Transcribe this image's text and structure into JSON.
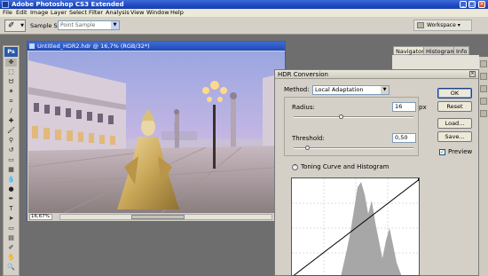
{
  "app": {
    "title": "Adobe Photoshop CS3 Extended",
    "window_buttons": [
      "_",
      "□",
      "×"
    ]
  },
  "menu": [
    "File",
    "Edit",
    "Image",
    "Layer",
    "Select",
    "Filter",
    "Analysis",
    "View",
    "Window",
    "Help"
  ],
  "options_bar": {
    "sample_size_label": "Sample Size:",
    "sample_size_value": "Point Sample",
    "workspace_label": "Workspace ▾"
  },
  "toolbox": {
    "logo": "Ps",
    "tools": [
      {
        "name": "move-tool-icon",
        "glyph": "✥"
      },
      {
        "name": "marquee-tool-icon",
        "glyph": "⬚"
      },
      {
        "name": "lasso-tool-icon",
        "glyph": "ᗢ"
      },
      {
        "name": "magic-wand-tool-icon",
        "glyph": "✶"
      },
      {
        "name": "crop-tool-icon",
        "glyph": "⌗"
      },
      {
        "name": "slice-tool-icon",
        "glyph": "∕"
      },
      {
        "name": "healing-brush-icon",
        "glyph": "✚"
      },
      {
        "name": "brush-tool-icon",
        "glyph": "🖌"
      },
      {
        "name": "clone-stamp-icon",
        "glyph": "⚲"
      },
      {
        "name": "history-brush-icon",
        "glyph": "↺"
      },
      {
        "name": "eraser-tool-icon",
        "glyph": "▭"
      },
      {
        "name": "gradient-tool-icon",
        "glyph": "▦"
      },
      {
        "name": "blur-tool-icon",
        "glyph": "💧"
      },
      {
        "name": "dodge-tool-icon",
        "glyph": "●"
      },
      {
        "name": "pen-tool-icon",
        "glyph": "✒"
      },
      {
        "name": "type-tool-icon",
        "glyph": "T"
      },
      {
        "name": "path-selection-icon",
        "glyph": "➤"
      },
      {
        "name": "shape-tool-icon",
        "glyph": "▭"
      },
      {
        "name": "notes-tool-icon",
        "glyph": "▤"
      },
      {
        "name": "eyedropper-tool-icon",
        "glyph": "✐"
      },
      {
        "name": "hand-tool-icon",
        "glyph": "✋"
      },
      {
        "name": "zoom-tool-icon",
        "glyph": "🔍"
      }
    ]
  },
  "document": {
    "title": "Untitled_HDR2.hdr @ 16,7% (RGB/32*)",
    "zoom": "16,67%"
  },
  "panels": {
    "tabs": [
      "Navigator",
      "Histogram",
      "Info"
    ]
  },
  "hdr_dialog": {
    "title": "HDR Conversion",
    "method_label": "Method:",
    "method_value": "Local Adaptation",
    "radius_label": "Radius:",
    "radius_value": "16",
    "radius_unit": "px",
    "radius_slider_fraction": 0.4,
    "threshold_label": "Threshold:",
    "threshold_value": "0,50",
    "threshold_slider_fraction": 0.12,
    "toning_label": "Toning Curve and Histogram",
    "buttons": {
      "ok": "OK",
      "reset": "Reset",
      "load": "Load...",
      "save": "Save..."
    },
    "preview_label": "Preview",
    "preview_checked": true
  }
}
